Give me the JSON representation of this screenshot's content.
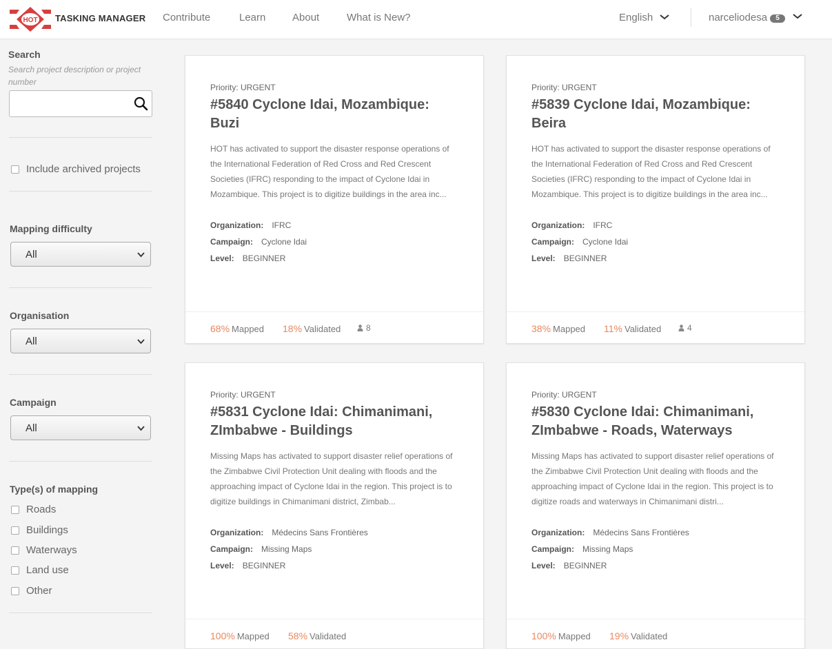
{
  "header": {
    "brand": "TASKING MANAGER",
    "logo_text": "HOT",
    "nav": [
      "Contribute",
      "Learn",
      "About",
      "What is New?"
    ],
    "language": "English",
    "username": "narceliodesa",
    "notification_count": "5"
  },
  "sidebar": {
    "search_label": "Search",
    "search_hint": "Search project description or project number",
    "search_value": "",
    "archived_label": "Include archived projects",
    "difficulty_label": "Mapping difficulty",
    "difficulty_value": "All",
    "organisation_label": "Organisation",
    "organisation_value": "All",
    "campaign_label": "Campaign",
    "campaign_value": "All",
    "mapping_types_label": "Type(s) of mapping",
    "mapping_types": [
      "Roads",
      "Buildings",
      "Waterways",
      "Land use",
      "Other"
    ]
  },
  "projects": [
    {
      "priority": "Priority: URGENT",
      "title": "#5840 Cyclone Idai, Mozambique: Buzi",
      "description": "HOT has activated to support the disaster response operations of the International Federation of Red Cross and Red Crescent Societies (IFRC) responding to the impact of Cyclone Idai in Mozambique. This project is to digitize buildings in the area inc...",
      "organization_label": "Organization:",
      "organization": "IFRC",
      "campaign_label": "Campaign:",
      "campaign": "Cyclone Idai",
      "level_label": "Level:",
      "level": "BEGINNER",
      "mapped_pct": "68%",
      "mapped_label": "Mapped",
      "validated_pct": "18%",
      "validated_label": "Validated",
      "contributors": "8"
    },
    {
      "priority": "Priority: URGENT",
      "title": "#5839 Cyclone Idai, Mozambique: Beira",
      "description": "HOT has activated to support the disaster response operations of the International Federation of Red Cross and Red Crescent Societies (IFRC) responding to the impact of Cyclone Idai in Mozambique. This project is to digitize buildings in the area inc...",
      "organization_label": "Organization:",
      "organization": "IFRC",
      "campaign_label": "Campaign:",
      "campaign": "Cyclone Idai",
      "level_label": "Level:",
      "level": "BEGINNER",
      "mapped_pct": "38%",
      "mapped_label": "Mapped",
      "validated_pct": "11%",
      "validated_label": "Validated",
      "contributors": "4"
    },
    {
      "priority": "Priority: URGENT",
      "title": "#5831 Cyclone Idai: Chimanimani, ZImbabwe - Buildings",
      "description": "Missing Maps has activated to support disaster relief operations of the Zimbabwe Civil Protection Unit dealing with floods and the approaching impact of Cyclone Idai in the region. This project is to digitize buildings in Chimanimani district, Zimbab...",
      "organization_label": "Organization:",
      "organization": "Médecins Sans Frontières",
      "campaign_label": "Campaign:",
      "campaign": "Missing Maps",
      "level_label": "Level:",
      "level": "BEGINNER",
      "mapped_pct": "100%",
      "mapped_label": "Mapped",
      "validated_pct": "58%",
      "validated_label": "Validated",
      "contributors": ""
    },
    {
      "priority": "Priority: URGENT",
      "title": "#5830 Cyclone Idai: Chimanimani, ZImbabwe - Roads, Waterways",
      "description": "Missing Maps has activated to support disaster relief operations of the Zimbabwe Civil Protection Unit dealing with floods and the approaching impact of Cyclone Idai in the region. This project is to digitize roads and waterways in Chimanimani distri...",
      "organization_label": "Organization:",
      "organization": "Médecins Sans Frontières",
      "campaign_label": "Campaign:",
      "campaign": "Missing Maps",
      "level_label": "Level:",
      "level": "BEGINNER",
      "mapped_pct": "100%",
      "mapped_label": "Mapped",
      "validated_pct": "19%",
      "validated_label": "Validated",
      "contributors": ""
    }
  ],
  "colors": {
    "brand_red": "#d73f3f",
    "accent_orange": "#e8885e",
    "text": "#666666"
  },
  "icons": [
    "hot-logo-icon",
    "chevron-down-icon",
    "search-icon",
    "user-icon"
  ]
}
